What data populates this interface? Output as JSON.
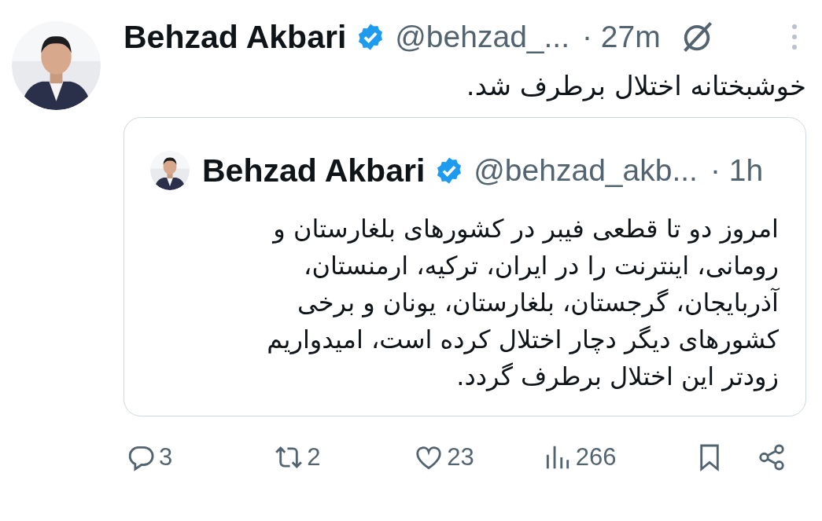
{
  "tweet": {
    "author": {
      "name": "Behzad Akbari",
      "verified": true,
      "handle": "@behzad_...",
      "time": "· 27m"
    },
    "text": "خوشبختانه اختلال برطرف شد.",
    "quote": {
      "author": {
        "name": "Behzad Akbari",
        "verified": true,
        "handle": "@behzad_akb...",
        "time": "· 1h"
      },
      "text_lines": [
        "امروز دو تا قطعی فیبر در کشورهای بلغارستان و",
        "رومانی، اینترنت را در ایران، ترکیه، ارمنستان،",
        "آذربایجان، گرجستان، بلغارستان، یونان و برخی",
        "کشورهای دیگر دچار اختلال کرده است، امیدواریم",
        "زودتر این اختلال برطرف گردد."
      ]
    },
    "actions": {
      "reply": {
        "count": "3"
      },
      "retweet": {
        "count": "2"
      },
      "like": {
        "count": "23"
      },
      "views": {
        "count": "266"
      },
      "bookmark": {
        "shown": true
      },
      "share": {
        "shown": true
      }
    }
  }
}
